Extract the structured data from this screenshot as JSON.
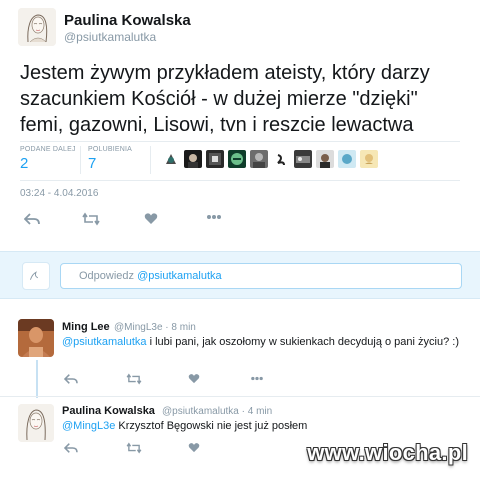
{
  "main_tweet": {
    "author_name": "Paulina Kowalska",
    "author_handle": "@psiutkamalutka",
    "text": "Jestem żywym przykładem ateisty, który darzy szacunkiem Kościół - w dużej mierze \"dzięki\" femi, gazowni, Lisowi, tvn i reszcie lewactwa",
    "stats": {
      "retweets_label": "PODANE DALEJ",
      "retweets_value": "2",
      "likes_label": "POLUBIENIA",
      "likes_value": "7"
    },
    "timestamp": "03:24 - 4.04.2016"
  },
  "reply_box": {
    "placeholder_prefix": "Odpowiedz ",
    "placeholder_mention": "@psiutkamalutka"
  },
  "replies": [
    {
      "author_name": "Ming Lee",
      "author_handle": "@MingL3e · 8 min",
      "mention": "@psiutkamalutka",
      "text": " i lubi pani, jak oszołomy w sukienkach decydują o pani życiu? :)"
    },
    {
      "author_name": "Paulina Kowalska",
      "author_handle": "@psiutkamalutka · 4 min",
      "mention": "@MingL3e",
      "text": " Krzysztof Bęgowski nie jest już posłem"
    }
  ],
  "watermark": "www.wiocha.pl",
  "icons": {
    "reply": "reply-icon",
    "retweet": "retweet-icon",
    "like": "heart-icon",
    "more": "more-icon"
  },
  "colors": {
    "accent": "#1da1f2",
    "muted": "#8899a6",
    "reply_bg": "#e8f5fd"
  }
}
